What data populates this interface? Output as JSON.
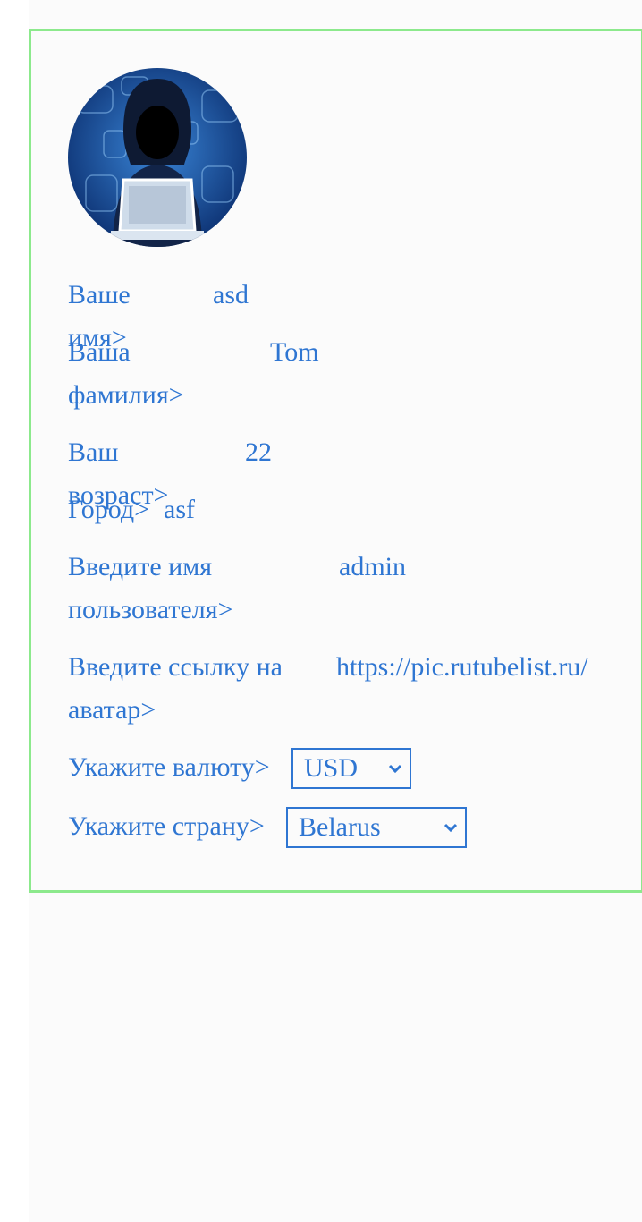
{
  "profile": {
    "fields": [
      {
        "label": "Ваше имя>",
        "value": "asd"
      },
      {
        "label": "Ваша\nфамилия>",
        "value": "Tom"
      },
      {
        "label": "Ваш возраст>",
        "value": "22"
      },
      {
        "label": "Город>",
        "value": "asf"
      },
      {
        "label": "Введите имя\nпользователя>",
        "value": "admin"
      },
      {
        "label": "Введите ссылку на\nаватар>",
        "value": "https://pic.rutubelist.ru/"
      }
    ],
    "currency": {
      "label": "Укажите валюту>",
      "selected": "USD"
    },
    "country": {
      "label": "Укажите страну>",
      "selected": "Belarus"
    }
  },
  "colors": {
    "accent": "#2f76d2",
    "card_border": "#8ce98c",
    "background": "#fbfbfb"
  },
  "icons": {
    "avatar": "hooded-hacker-avatar",
    "select_arrow": "chevron-down-icon"
  }
}
